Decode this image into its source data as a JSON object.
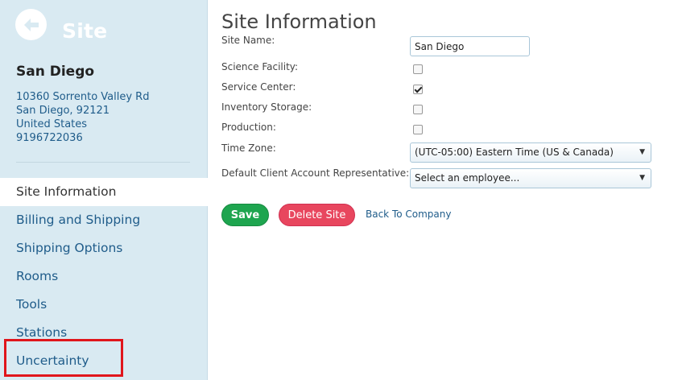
{
  "sidebar": {
    "title": "Site",
    "site_name": "San Diego",
    "address": [
      "10360 Sorrento Valley Rd",
      "San Diego, 92121",
      "United States",
      "9196722036"
    ],
    "nav": [
      {
        "label": "Site Information"
      },
      {
        "label": "Billing and Shipping"
      },
      {
        "label": "Shipping Options"
      },
      {
        "label": "Rooms"
      },
      {
        "label": "Tools"
      },
      {
        "label": "Stations"
      },
      {
        "label": "Uncertainty"
      }
    ],
    "active_index": 0,
    "highlight_color": "#e0161c"
  },
  "main": {
    "title": "Site Information",
    "fields": {
      "site_name_label": "Site Name:",
      "site_name_value": "San Diego",
      "science_label": "Science Facility:",
      "science_checked": false,
      "service_label": "Service Center:",
      "service_checked": true,
      "inventory_label": "Inventory Storage:",
      "inventory_checked": false,
      "production_label": "Production:",
      "production_checked": false,
      "timezone_label": "Time Zone:",
      "timezone_value": "(UTC-05:00) Eastern Time (US & Canada)",
      "rep_label": "Default Client Account Representative:",
      "rep_value": "Select an employee..."
    },
    "buttons": {
      "save": "Save",
      "delete": "Delete Site",
      "back": "Back To Company"
    }
  },
  "colors": {
    "sidebar_bg": "#d9eaf2",
    "link": "#1f5c8a",
    "save": "#1ea54f",
    "delete": "#e8465e"
  }
}
